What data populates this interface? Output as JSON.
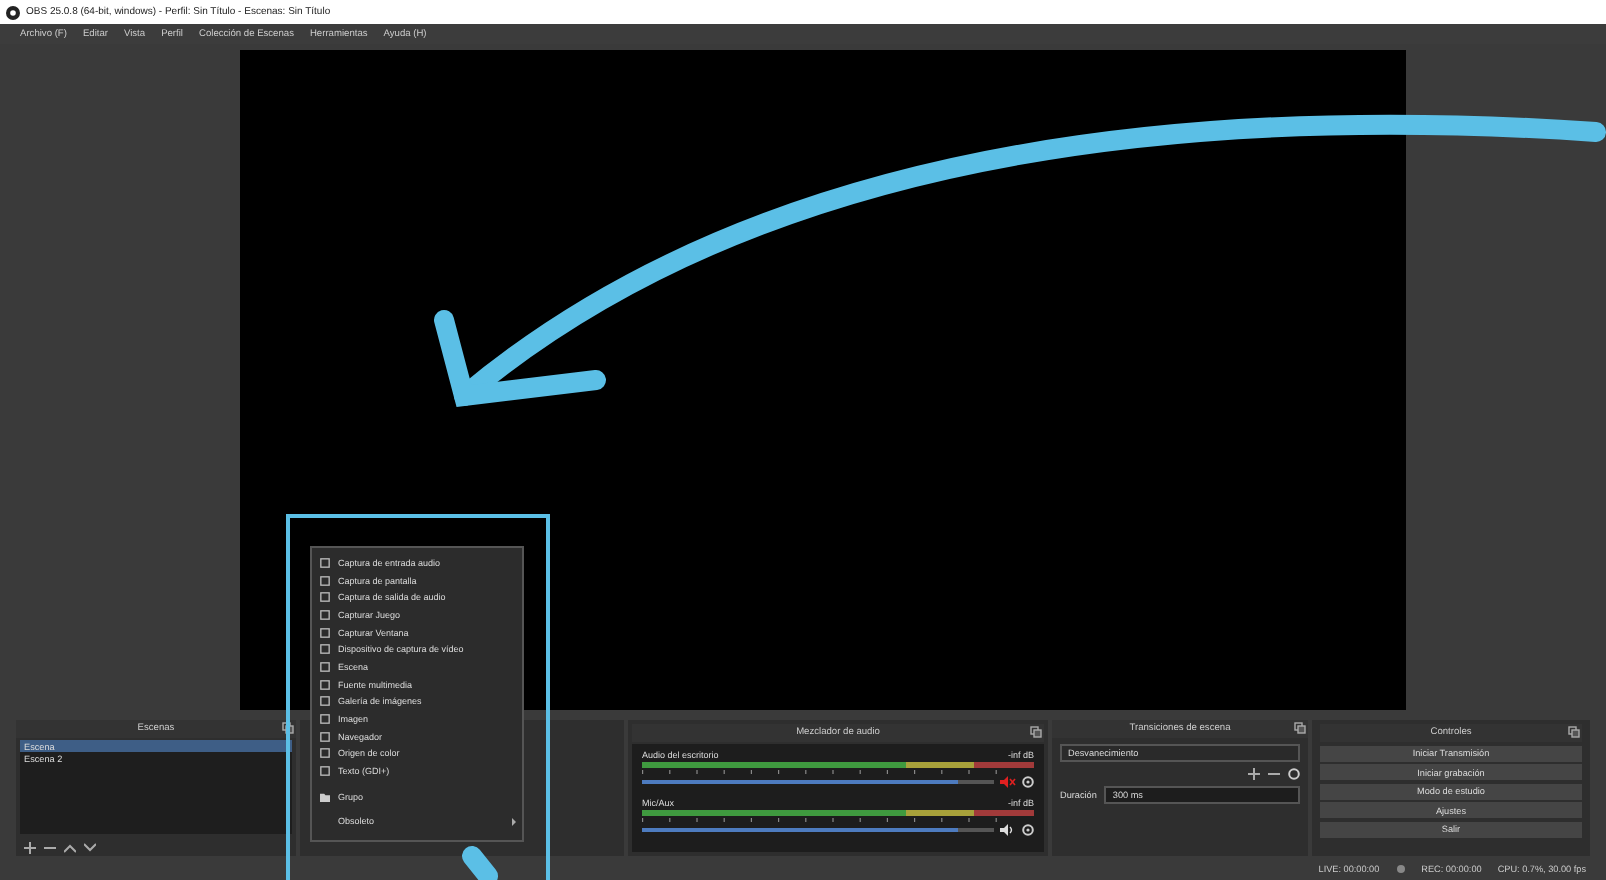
{
  "window": {
    "title": "OBS 25.0.8 (64-bit, windows) - Perfil: Sin Título - Escenas: Sin Título"
  },
  "menu_bar": [
    "Archivo (F)",
    "Editar",
    "Vista",
    "Perfil",
    "Colección de Escenas",
    "Herramientas",
    "Ayuda (H)"
  ],
  "scenes": {
    "title": "Escenas",
    "items": [
      {
        "label": "Escena",
        "selected": true
      },
      {
        "label": "Escena 2",
        "selected": false
      }
    ]
  },
  "audio_mixer": {
    "title": "Mezclador de audio",
    "channels": [
      {
        "name": "Audio del escritorio",
        "reading": "-inf dB",
        "level": 0.9,
        "muted": true
      },
      {
        "name": "Mic/Aux",
        "reading": "-inf dB",
        "level": 0.9,
        "muted": false
      }
    ]
  },
  "transitions": {
    "title": "Transiciones de escena",
    "transition": "Desvanecimiento",
    "duration_label": "Duración",
    "duration": "300 ms"
  },
  "controls": {
    "title": "Controles",
    "buttons": [
      "Iniciar Transmisión",
      "Iniciar grabación",
      "Modo de estudio",
      "Ajustes",
      "Salir"
    ]
  },
  "context_menu": [
    {
      "label": "Captura de entrada audio",
      "kind": "item"
    },
    {
      "label": "Captura de pantalla",
      "kind": "item"
    },
    {
      "label": "Captura de salida de audio",
      "kind": "item"
    },
    {
      "label": "Capturar Juego",
      "kind": "item"
    },
    {
      "label": "Capturar Ventana",
      "kind": "item"
    },
    {
      "label": "Dispositivo de captura de vídeo",
      "kind": "item"
    },
    {
      "label": "Escena",
      "kind": "item"
    },
    {
      "label": "Fuente multimedia",
      "kind": "item"
    },
    {
      "label": "Galería de imágenes",
      "kind": "item"
    },
    {
      "label": "Imagen",
      "kind": "item"
    },
    {
      "label": "Navegador",
      "kind": "item"
    },
    {
      "label": "Origen de color",
      "kind": "item"
    },
    {
      "label": "Texto (GDI+)",
      "kind": "item"
    },
    {
      "label": "Grupo",
      "kind": "group"
    },
    {
      "label": "Obsoleto",
      "kind": "submenu"
    }
  ],
  "status_bar": {
    "live": "LIVE: 00:00:00",
    "rec": "REC: 00:00:00",
    "cpu": "CPU: 0.7%, 30.00 fps"
  }
}
